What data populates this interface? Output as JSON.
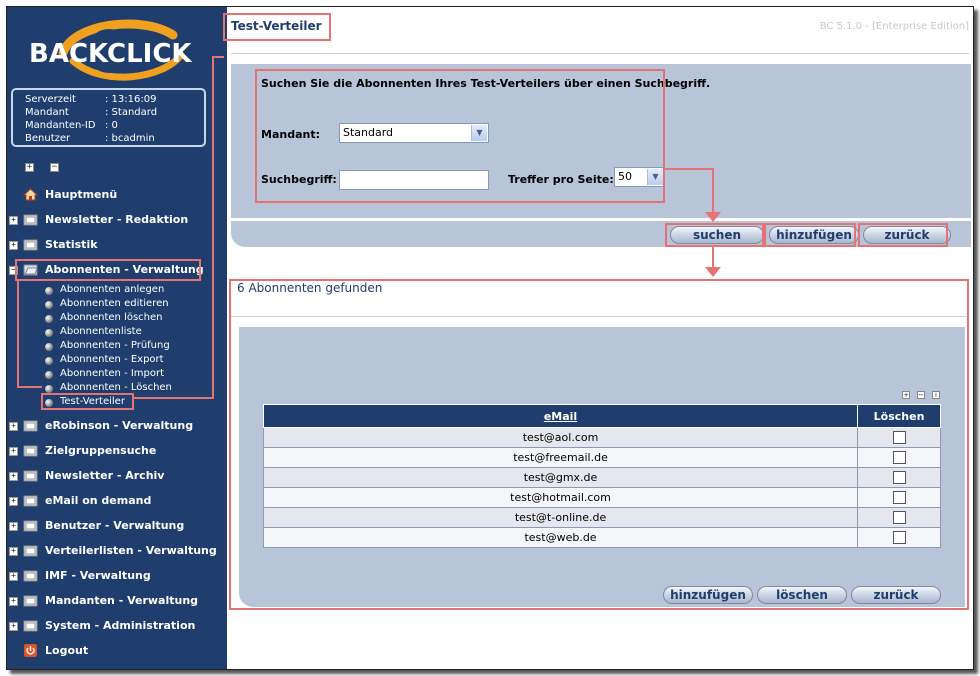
{
  "app": {
    "logo_text": "BACKCLICK",
    "version": "BC 5.1.0 - [Enterprise Edition]"
  },
  "info": {
    "rows": [
      {
        "key": "Serverzeit",
        "value": ": 13:16:09"
      },
      {
        "key": "Mandant",
        "value": ": Standard"
      },
      {
        "key": "Mandanten-ID",
        "value": ": 0"
      },
      {
        "key": "Benutzer",
        "value": ": bcadmin"
      }
    ]
  },
  "sidebar": {
    "expand_all": "+",
    "collapse_all": "−",
    "items": [
      {
        "label": "Hauptmenü",
        "icon": "home-icon",
        "expander": ""
      },
      {
        "label": "Newsletter - Redaktion",
        "icon": "folder-icon",
        "expander": "+"
      },
      {
        "label": "Statistik",
        "icon": "folder-icon",
        "expander": "+"
      },
      {
        "label": "Abonnenten - Verwaltung",
        "icon": "folder-open-icon",
        "expander": "−"
      },
      {
        "label": "eRobinson - Verwaltung",
        "icon": "folder-icon",
        "expander": "+"
      },
      {
        "label": "Zielgruppensuche",
        "icon": "folder-icon",
        "expander": "+"
      },
      {
        "label": "Newsletter - Archiv",
        "icon": "folder-icon",
        "expander": "+"
      },
      {
        "label": "eMail on demand",
        "icon": "folder-icon",
        "expander": "+"
      },
      {
        "label": "Benutzer - Verwaltung",
        "icon": "folder-icon",
        "expander": "+"
      },
      {
        "label": "Verteilerlisten - Verwaltung",
        "icon": "folder-icon",
        "expander": "+"
      },
      {
        "label": "IMF - Verwaltung",
        "icon": "folder-icon",
        "expander": "+"
      },
      {
        "label": "Mandanten - Verwaltung",
        "icon": "folder-icon",
        "expander": "+"
      },
      {
        "label": "System - Administration",
        "icon": "folder-icon",
        "expander": "+"
      },
      {
        "label": "Logout",
        "icon": "logout-icon",
        "expander": ""
      }
    ],
    "subitems": [
      "Abonnenten anlegen",
      "Abonnenten editieren",
      "Abonnenten löschen",
      "Abonnentenliste",
      "Abonnenten - Prüfung",
      "Abonnenten - Export",
      "Abonnenten - Import",
      "Abonnenten - Löschen",
      "Test-Verteiler"
    ]
  },
  "main": {
    "title": "Test-Verteiler",
    "search": {
      "intro": "Suchen Sie die Abonnenten Ihres Test-Verteilers über einen Suchbegriff.",
      "mandant_label": "Mandant:",
      "mandant_value": "Standard",
      "term_label": "Suchbegriff:",
      "term_value": "",
      "per_page_label": "Treffer pro Seite:",
      "per_page_value": "50"
    },
    "buttons": {
      "search": "suchen",
      "add": "hinzufügen",
      "back": "zurück",
      "delete": "löschen"
    },
    "results": {
      "title": "6 Abonnenten gefunden",
      "mini_buttons": [
        "+",
        "−",
        "i"
      ],
      "col_email": "eMail",
      "col_delete": "Löschen",
      "rows": [
        "test@aol.com",
        "test@freemail.de",
        "test@gmx.de",
        "test@hotmail.com",
        "test@t-online.de",
        "test@web.de"
      ]
    }
  },
  "colors": {
    "sidebar": "#1f3e6e",
    "panel": "#b8c5d8",
    "highlight": "#e57373"
  }
}
